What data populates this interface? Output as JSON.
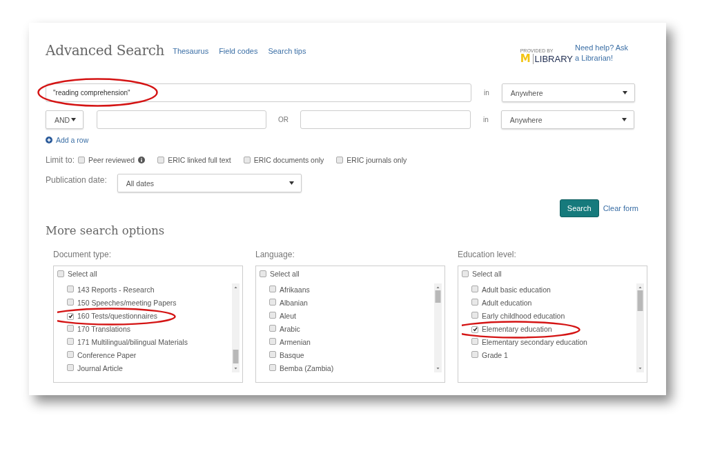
{
  "header": {
    "title": "Advanced Search",
    "links": [
      "Thesaurus",
      "Field codes",
      "Search tips"
    ],
    "logo": {
      "provided_by": "PROVIDED BY",
      "mark": "M",
      "name": "LIBRARY"
    },
    "help_link": "Need help? Ask a Librarian!"
  },
  "search_rows": [
    {
      "kind": "first",
      "value": "\"reading comprehension\"",
      "circled": true,
      "in_label": "in",
      "field": "Anywhere"
    },
    {
      "kind": "extra",
      "operator": "AND",
      "value": "",
      "or_label": "OR",
      "value_2": "",
      "in_label": "in",
      "field": "Anywhere"
    }
  ],
  "add_row": "Add a row",
  "limit": {
    "label": "Limit to:",
    "options": [
      {
        "label": "Peer reviewed",
        "checked": false,
        "info": true
      },
      {
        "label": "ERIC linked full text",
        "checked": false,
        "info": false
      },
      {
        "label": "ERIC documents only",
        "checked": false,
        "info": false
      },
      {
        "label": "ERIC journals only",
        "checked": false,
        "info": false
      }
    ]
  },
  "publication_date": {
    "label": "Publication date:",
    "value": "All dates"
  },
  "actions": {
    "search": "Search",
    "clear": "Clear form"
  },
  "more_options": {
    "title": "More search options",
    "groups": [
      {
        "label": "Document type:",
        "select_all": {
          "label": "Select all",
          "checked": false
        },
        "items": [
          {
            "label": "143 Reports - Research",
            "checked": false,
            "circled": false
          },
          {
            "label": "150 Speeches/meeting Papers",
            "checked": false,
            "circled": false
          },
          {
            "label": "160 Tests/questionnaires",
            "checked": true,
            "circled": true
          },
          {
            "label": "170 Translations",
            "checked": false,
            "circled": false
          },
          {
            "label": "171 Multilingual/bilingual Materials",
            "checked": false,
            "circled": false
          },
          {
            "label": "Conference Paper",
            "checked": false,
            "circled": false
          },
          {
            "label": "Journal Article",
            "checked": false,
            "circled": false
          }
        ]
      },
      {
        "label": "Language:",
        "select_all": {
          "label": "Select all",
          "checked": false
        },
        "items": [
          {
            "label": "Afrikaans",
            "checked": false,
            "circled": false
          },
          {
            "label": "Albanian",
            "checked": false,
            "circled": false
          },
          {
            "label": "Aleut",
            "checked": false,
            "circled": false
          },
          {
            "label": "Arabic",
            "checked": false,
            "circled": false
          },
          {
            "label": "Armenian",
            "checked": false,
            "circled": false
          },
          {
            "label": "Basque",
            "checked": false,
            "circled": false
          },
          {
            "label": "Bemba (Zambia)",
            "checked": false,
            "circled": false
          }
        ]
      },
      {
        "label": "Education level:",
        "select_all": {
          "label": "Select all",
          "checked": false
        },
        "items": [
          {
            "label": "Adult basic education",
            "checked": false,
            "circled": false
          },
          {
            "label": "Adult education",
            "checked": false,
            "circled": false
          },
          {
            "label": "Early childhood education",
            "checked": false,
            "circled": false
          },
          {
            "label": "Elementary education",
            "checked": true,
            "circled": true
          },
          {
            "label": "Elementary secondary education",
            "checked": false,
            "circled": false
          },
          {
            "label": "Grade 1",
            "checked": false,
            "circled": false
          }
        ]
      }
    ]
  }
}
